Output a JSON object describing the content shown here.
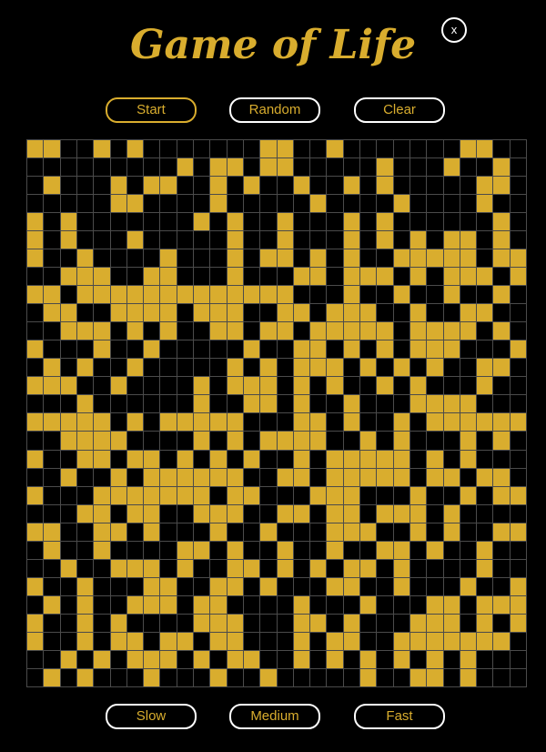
{
  "title": "Game of Life",
  "close_label": "x",
  "controls": {
    "start": "Start",
    "random": "Random",
    "clear": "Clear"
  },
  "speed": {
    "slow": "Slow",
    "medium": "Medium",
    "fast": "Fast"
  },
  "colors": {
    "alive": "#d9ad2e",
    "dead": "#000000",
    "grid_line": "#4b4b4b"
  },
  "grid": {
    "cols": 30,
    "rows": 30,
    "alive_cells": [
      [
        0,
        0
      ],
      [
        0,
        1
      ],
      [
        0,
        4
      ],
      [
        0,
        6
      ],
      [
        0,
        14
      ],
      [
        0,
        15
      ],
      [
        0,
        18
      ],
      [
        0,
        26
      ],
      [
        0,
        27
      ],
      [
        1,
        9
      ],
      [
        1,
        11
      ],
      [
        1,
        12
      ],
      [
        1,
        14
      ],
      [
        1,
        15
      ],
      [
        1,
        21
      ],
      [
        1,
        25
      ],
      [
        1,
        28
      ],
      [
        2,
        1
      ],
      [
        2,
        5
      ],
      [
        2,
        7
      ],
      [
        2,
        8
      ],
      [
        2,
        11
      ],
      [
        2,
        13
      ],
      [
        2,
        16
      ],
      [
        2,
        19
      ],
      [
        2,
        21
      ],
      [
        2,
        27
      ],
      [
        2,
        28
      ],
      [
        3,
        5
      ],
      [
        3,
        6
      ],
      [
        3,
        11
      ],
      [
        3,
        17
      ],
      [
        3,
        22
      ],
      [
        3,
        27
      ],
      [
        4,
        0
      ],
      [
        4,
        2
      ],
      [
        4,
        10
      ],
      [
        4,
        12
      ],
      [
        4,
        15
      ],
      [
        4,
        19
      ],
      [
        4,
        21
      ],
      [
        4,
        28
      ],
      [
        5,
        0
      ],
      [
        5,
        2
      ],
      [
        5,
        6
      ],
      [
        5,
        12
      ],
      [
        5,
        15
      ],
      [
        5,
        19
      ],
      [
        5,
        21
      ],
      [
        5,
        23
      ],
      [
        5,
        25
      ],
      [
        5,
        26
      ],
      [
        5,
        28
      ],
      [
        6,
        0
      ],
      [
        6,
        3
      ],
      [
        6,
        8
      ],
      [
        6,
        12
      ],
      [
        6,
        14
      ],
      [
        6,
        15
      ],
      [
        6,
        17
      ],
      [
        6,
        19
      ],
      [
        6,
        22
      ],
      [
        6,
        23
      ],
      [
        6,
        24
      ],
      [
        6,
        25
      ],
      [
        6,
        26
      ],
      [
        6,
        28
      ],
      [
        6,
        29
      ],
      [
        7,
        2
      ],
      [
        7,
        3
      ],
      [
        7,
        4
      ],
      [
        7,
        7
      ],
      [
        7,
        8
      ],
      [
        7,
        12
      ],
      [
        7,
        16
      ],
      [
        7,
        17
      ],
      [
        7,
        19
      ],
      [
        7,
        20
      ],
      [
        7,
        21
      ],
      [
        7,
        23
      ],
      [
        7,
        25
      ],
      [
        7,
        26
      ],
      [
        7,
        27
      ],
      [
        7,
        29
      ],
      [
        8,
        0
      ],
      [
        8,
        1
      ],
      [
        8,
        3
      ],
      [
        8,
        4
      ],
      [
        8,
        5
      ],
      [
        8,
        6
      ],
      [
        8,
        7
      ],
      [
        8,
        8
      ],
      [
        8,
        9
      ],
      [
        8,
        10
      ],
      [
        8,
        11
      ],
      [
        8,
        12
      ],
      [
        8,
        13
      ],
      [
        8,
        14
      ],
      [
        8,
        15
      ],
      [
        8,
        19
      ],
      [
        8,
        22
      ],
      [
        8,
        25
      ],
      [
        8,
        28
      ],
      [
        9,
        1
      ],
      [
        9,
        2
      ],
      [
        9,
        5
      ],
      [
        9,
        6
      ],
      [
        9,
        7
      ],
      [
        9,
        8
      ],
      [
        9,
        10
      ],
      [
        9,
        11
      ],
      [
        9,
        12
      ],
      [
        9,
        15
      ],
      [
        9,
        16
      ],
      [
        9,
        18
      ],
      [
        9,
        19
      ],
      [
        9,
        20
      ],
      [
        9,
        23
      ],
      [
        9,
        26
      ],
      [
        9,
        27
      ],
      [
        10,
        2
      ],
      [
        10,
        3
      ],
      [
        10,
        4
      ],
      [
        10,
        6
      ],
      [
        10,
        8
      ],
      [
        10,
        11
      ],
      [
        10,
        12
      ],
      [
        10,
        14
      ],
      [
        10,
        15
      ],
      [
        10,
        17
      ],
      [
        10,
        18
      ],
      [
        10,
        19
      ],
      [
        10,
        20
      ],
      [
        10,
        21
      ],
      [
        10,
        23
      ],
      [
        10,
        24
      ],
      [
        10,
        25
      ],
      [
        10,
        26
      ],
      [
        10,
        28
      ],
      [
        11,
        0
      ],
      [
        11,
        4
      ],
      [
        11,
        7
      ],
      [
        11,
        13
      ],
      [
        11,
        16
      ],
      [
        11,
        17
      ],
      [
        11,
        19
      ],
      [
        11,
        21
      ],
      [
        11,
        23
      ],
      [
        11,
        24
      ],
      [
        11,
        25
      ],
      [
        11,
        29
      ],
      [
        12,
        1
      ],
      [
        12,
        3
      ],
      [
        12,
        6
      ],
      [
        12,
        12
      ],
      [
        12,
        14
      ],
      [
        12,
        16
      ],
      [
        12,
        17
      ],
      [
        12,
        18
      ],
      [
        12,
        20
      ],
      [
        12,
        22
      ],
      [
        12,
        24
      ],
      [
        12,
        27
      ],
      [
        12,
        28
      ],
      [
        13,
        0
      ],
      [
        13,
        1
      ],
      [
        13,
        2
      ],
      [
        13,
        5
      ],
      [
        13,
        10
      ],
      [
        13,
        12
      ],
      [
        13,
        13
      ],
      [
        13,
        14
      ],
      [
        13,
        16
      ],
      [
        13,
        18
      ],
      [
        13,
        21
      ],
      [
        13,
        23
      ],
      [
        13,
        27
      ],
      [
        14,
        3
      ],
      [
        14,
        10
      ],
      [
        14,
        13
      ],
      [
        14,
        14
      ],
      [
        14,
        16
      ],
      [
        14,
        19
      ],
      [
        14,
        23
      ],
      [
        14,
        24
      ],
      [
        14,
        25
      ],
      [
        14,
        26
      ],
      [
        15,
        0
      ],
      [
        15,
        1
      ],
      [
        15,
        2
      ],
      [
        15,
        3
      ],
      [
        15,
        4
      ],
      [
        15,
        6
      ],
      [
        15,
        8
      ],
      [
        15,
        9
      ],
      [
        15,
        10
      ],
      [
        15,
        11
      ],
      [
        15,
        12
      ],
      [
        15,
        16
      ],
      [
        15,
        17
      ],
      [
        15,
        19
      ],
      [
        15,
        22
      ],
      [
        15,
        24
      ],
      [
        15,
        25
      ],
      [
        15,
        26
      ],
      [
        15,
        27
      ],
      [
        15,
        28
      ],
      [
        15,
        29
      ],
      [
        16,
        2
      ],
      [
        16,
        3
      ],
      [
        16,
        4
      ],
      [
        16,
        5
      ],
      [
        16,
        10
      ],
      [
        16,
        12
      ],
      [
        16,
        14
      ],
      [
        16,
        15
      ],
      [
        16,
        16
      ],
      [
        16,
        17
      ],
      [
        16,
        20
      ],
      [
        16,
        22
      ],
      [
        16,
        26
      ],
      [
        16,
        28
      ],
      [
        17,
        0
      ],
      [
        17,
        3
      ],
      [
        17,
        4
      ],
      [
        17,
        6
      ],
      [
        17,
        7
      ],
      [
        17,
        9
      ],
      [
        17,
        11
      ],
      [
        17,
        13
      ],
      [
        17,
        16
      ],
      [
        17,
        18
      ],
      [
        17,
        19
      ],
      [
        17,
        20
      ],
      [
        17,
        21
      ],
      [
        17,
        22
      ],
      [
        17,
        24
      ],
      [
        17,
        26
      ],
      [
        18,
        2
      ],
      [
        18,
        5
      ],
      [
        18,
        7
      ],
      [
        18,
        8
      ],
      [
        18,
        9
      ],
      [
        18,
        10
      ],
      [
        18,
        11
      ],
      [
        18,
        12
      ],
      [
        18,
        15
      ],
      [
        18,
        16
      ],
      [
        18,
        18
      ],
      [
        18,
        19
      ],
      [
        18,
        20
      ],
      [
        18,
        21
      ],
      [
        18,
        22
      ],
      [
        18,
        24
      ],
      [
        18,
        25
      ],
      [
        18,
        27
      ],
      [
        18,
        28
      ],
      [
        19,
        0
      ],
      [
        19,
        4
      ],
      [
        19,
        5
      ],
      [
        19,
        6
      ],
      [
        19,
        7
      ],
      [
        19,
        8
      ],
      [
        19,
        9
      ],
      [
        19,
        10
      ],
      [
        19,
        12
      ],
      [
        19,
        13
      ],
      [
        19,
        17
      ],
      [
        19,
        18
      ],
      [
        19,
        19
      ],
      [
        19,
        23
      ],
      [
        19,
        26
      ],
      [
        19,
        28
      ],
      [
        19,
        29
      ],
      [
        20,
        3
      ],
      [
        20,
        4
      ],
      [
        20,
        6
      ],
      [
        20,
        7
      ],
      [
        20,
        10
      ],
      [
        20,
        11
      ],
      [
        20,
        12
      ],
      [
        20,
        15
      ],
      [
        20,
        16
      ],
      [
        20,
        18
      ],
      [
        20,
        19
      ],
      [
        20,
        21
      ],
      [
        20,
        22
      ],
      [
        20,
        23
      ],
      [
        20,
        25
      ],
      [
        21,
        0
      ],
      [
        21,
        1
      ],
      [
        21,
        4
      ],
      [
        21,
        5
      ],
      [
        21,
        7
      ],
      [
        21,
        11
      ],
      [
        21,
        14
      ],
      [
        21,
        18
      ],
      [
        21,
        19
      ],
      [
        21,
        20
      ],
      [
        21,
        23
      ],
      [
        21,
        25
      ],
      [
        21,
        28
      ],
      [
        21,
        29
      ],
      [
        22,
        1
      ],
      [
        22,
        4
      ],
      [
        22,
        9
      ],
      [
        22,
        10
      ],
      [
        22,
        12
      ],
      [
        22,
        15
      ],
      [
        22,
        18
      ],
      [
        22,
        21
      ],
      [
        22,
        22
      ],
      [
        22,
        24
      ],
      [
        22,
        27
      ],
      [
        23,
        2
      ],
      [
        23,
        5
      ],
      [
        23,
        6
      ],
      [
        23,
        7
      ],
      [
        23,
        9
      ],
      [
        23,
        12
      ],
      [
        23,
        13
      ],
      [
        23,
        15
      ],
      [
        23,
        17
      ],
      [
        23,
        19
      ],
      [
        23,
        20
      ],
      [
        23,
        22
      ],
      [
        23,
        27
      ],
      [
        24,
        0
      ],
      [
        24,
        3
      ],
      [
        24,
        7
      ],
      [
        24,
        8
      ],
      [
        24,
        11
      ],
      [
        24,
        12
      ],
      [
        24,
        14
      ],
      [
        24,
        18
      ],
      [
        24,
        19
      ],
      [
        24,
        22
      ],
      [
        24,
        26
      ],
      [
        24,
        29
      ],
      [
        25,
        1
      ],
      [
        25,
        3
      ],
      [
        25,
        6
      ],
      [
        25,
        7
      ],
      [
        25,
        8
      ],
      [
        25,
        10
      ],
      [
        25,
        11
      ],
      [
        25,
        16
      ],
      [
        25,
        20
      ],
      [
        25,
        24
      ],
      [
        25,
        25
      ],
      [
        25,
        27
      ],
      [
        25,
        28
      ],
      [
        25,
        29
      ],
      [
        26,
        0
      ],
      [
        26,
        3
      ],
      [
        26,
        5
      ],
      [
        26,
        10
      ],
      [
        26,
        11
      ],
      [
        26,
        12
      ],
      [
        26,
        16
      ],
      [
        26,
        17
      ],
      [
        26,
        19
      ],
      [
        26,
        23
      ],
      [
        26,
        24
      ],
      [
        26,
        25
      ],
      [
        26,
        27
      ],
      [
        26,
        29
      ],
      [
        27,
        0
      ],
      [
        27,
        3
      ],
      [
        27,
        5
      ],
      [
        27,
        6
      ],
      [
        27,
        8
      ],
      [
        27,
        9
      ],
      [
        27,
        11
      ],
      [
        27,
        12
      ],
      [
        27,
        16
      ],
      [
        27,
        18
      ],
      [
        27,
        19
      ],
      [
        27,
        22
      ],
      [
        27,
        23
      ],
      [
        27,
        24
      ],
      [
        27,
        25
      ],
      [
        27,
        26
      ],
      [
        27,
        27
      ],
      [
        27,
        28
      ],
      [
        28,
        2
      ],
      [
        28,
        4
      ],
      [
        28,
        6
      ],
      [
        28,
        7
      ],
      [
        28,
        8
      ],
      [
        28,
        10
      ],
      [
        28,
        12
      ],
      [
        28,
        13
      ],
      [
        28,
        16
      ],
      [
        28,
        18
      ],
      [
        28,
        20
      ],
      [
        28,
        22
      ],
      [
        28,
        24
      ],
      [
        28,
        26
      ],
      [
        29,
        1
      ],
      [
        29,
        3
      ],
      [
        29,
        7
      ],
      [
        29,
        11
      ],
      [
        29,
        14
      ],
      [
        29,
        20
      ],
      [
        29,
        23
      ],
      [
        29,
        24
      ],
      [
        29,
        26
      ]
    ]
  }
}
